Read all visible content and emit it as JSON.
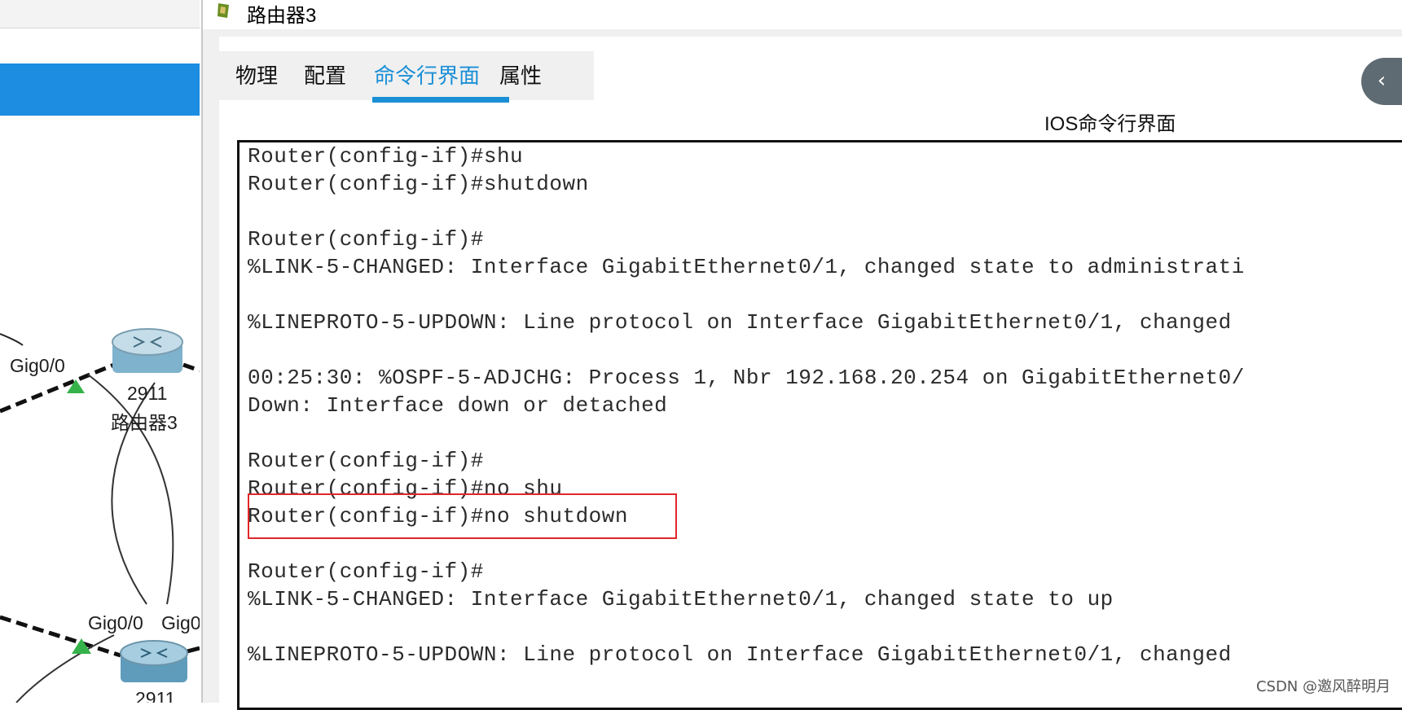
{
  "window": {
    "title": "路由器3",
    "tabs": [
      {
        "label": "物理"
      },
      {
        "label": "配置"
      },
      {
        "label": "命令行界面",
        "active": true
      },
      {
        "label": "属性"
      }
    ],
    "cli_title": "IOS命令行界面"
  },
  "terminal": {
    "lines": [
      "Router(config-if)#shu",
      "Router(config-if)#shutdown",
      "Router(config-if)#",
      "%LINK-5-CHANGED: Interface GigabitEthernet0/1, changed state to administrati",
      "%LINEPROTO-5-UPDOWN: Line protocol on Interface GigabitEthernet0/1, changed",
      "00:25:30: %OSPF-5-ADJCHG: Process 1, Nbr 192.168.20.254 on GigabitEthernet0/",
      "Down: Interface down or detached",
      "Router(config-if)#",
      "Router(config-if)#no shu",
      "Router(config-if)#no shutdown",
      "Router(config-if)#",
      "%LINK-5-CHANGED: Interface GigabitEthernet0/1, changed state to up",
      "%LINEPROTO-5-UPDOWN: Line protocol on Interface GigabitEthernet0/1, changed"
    ],
    "highlight_color": "#e0262a"
  },
  "topology": {
    "labels": {
      "if1": "Gig0/0",
      "router3_model": "2911",
      "router3_name": "路由器3",
      "if2": "Gig0/0",
      "if3": "Gig0",
      "router_bottom_model": "2911"
    }
  },
  "collapse_button": {
    "icon": "chevron-left-icon",
    "glyph": "‹"
  },
  "watermark": "CSDN @邀风醉明月",
  "colors": {
    "accent": "#1a8fd6",
    "topology_bar": "#1c8de0",
    "highlight": "#e0262a"
  }
}
